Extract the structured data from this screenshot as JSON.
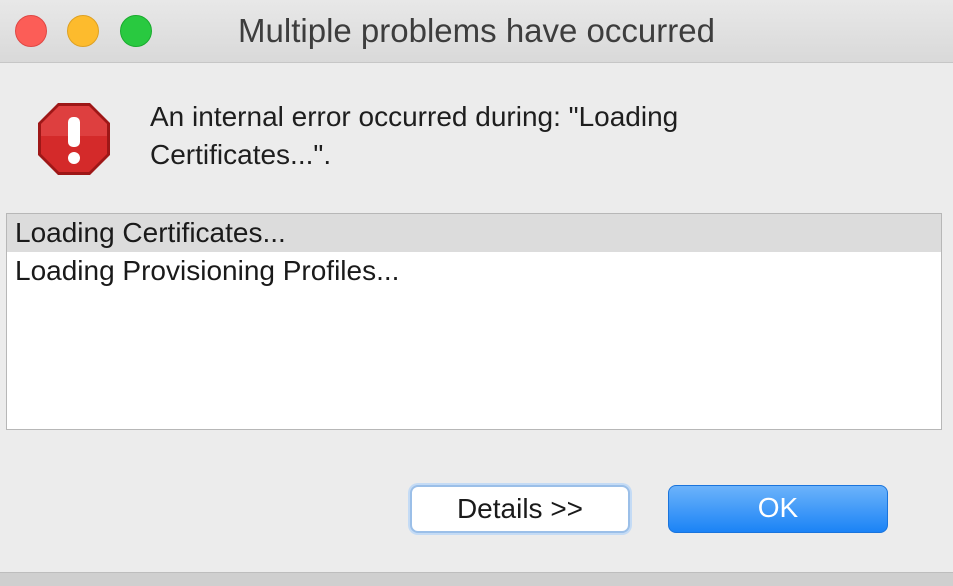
{
  "window": {
    "title": "Multiple problems have occurred"
  },
  "dialog": {
    "message_line1": "An internal error occurred during: \"Loading",
    "message_line2": "Certificates...\".",
    "icon": "error-stop-icon",
    "problems": [
      {
        "label": "Loading Certificates...",
        "selected": true
      },
      {
        "label": "Loading Provisioning Profiles...",
        "selected": false
      }
    ],
    "buttons": {
      "details_label": "Details >>",
      "ok_label": "OK"
    }
  },
  "colors": {
    "error_icon": "#d42a2a",
    "ok_button": "#1b83f6",
    "close": "#fc5d57",
    "minimize": "#fdbb2d",
    "zoom": "#29c940"
  }
}
